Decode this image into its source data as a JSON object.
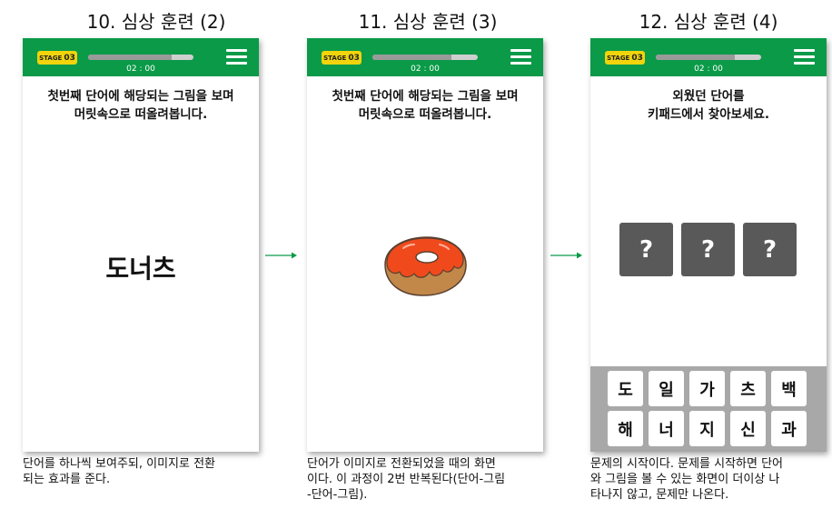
{
  "panels": [
    {
      "title": "10. 심상 훈련 (2)",
      "stage_label": "STAGE",
      "stage_num": "03",
      "progress": 0.79,
      "timer": "02 : 00",
      "instruction_line1": "첫번째 단어에 해당되는 그림을 보며",
      "instruction_line2": "머릿속으로 떠올려봅니다.",
      "word": "도너츠",
      "caption_line1": "단어를 하나씩 보여주되, 이미지로 전환",
      "caption_line2": "되는 효과를 준다."
    },
    {
      "title": "11. 심상 훈련 (3)",
      "stage_label": "STAGE",
      "stage_num": "03",
      "progress": 0.75,
      "timer": "02 : 00",
      "instruction_line1": "첫번째 단어에 해당되는 그림을 보며",
      "instruction_line2": "머릿속으로 떠올려봅니다.",
      "image_icon": "donut-icon",
      "caption_line1": "단어가 이미지로 전환되었을 때의 화면",
      "caption_line2": "이다. 이 과정이 2번 반복된다(단어-그림",
      "caption_line3": "-단어-그림)."
    },
    {
      "title": "12. 심상 훈련 (4)",
      "stage_label": "STAGE",
      "stage_num": "03",
      "progress": 0.75,
      "timer": "02 : 00",
      "instruction_line1": "외웠던 단어를",
      "instruction_line2": "키패드에서 찾아보세요.",
      "answer_slots": [
        "?",
        "?",
        "?"
      ],
      "keypad_row1": [
        "도",
        "일",
        "가",
        "츠",
        "백"
      ],
      "keypad_row2": [
        "해",
        "너",
        "지",
        "신",
        "과"
      ],
      "caption_line1": "문제의 시작이다. 문제를 시작하면 단어",
      "caption_line2": "와 그림을 볼 수 있는 화면이 더이상 나",
      "caption_line3": "타나지 않고, 문제만 나온다."
    }
  ],
  "colors": {
    "topbar": "#0a9a48",
    "badge": "#f2d40c",
    "arrow": "#0a9a48",
    "donut_icing": "#f04a1c",
    "donut_dough": "#c1884a"
  }
}
